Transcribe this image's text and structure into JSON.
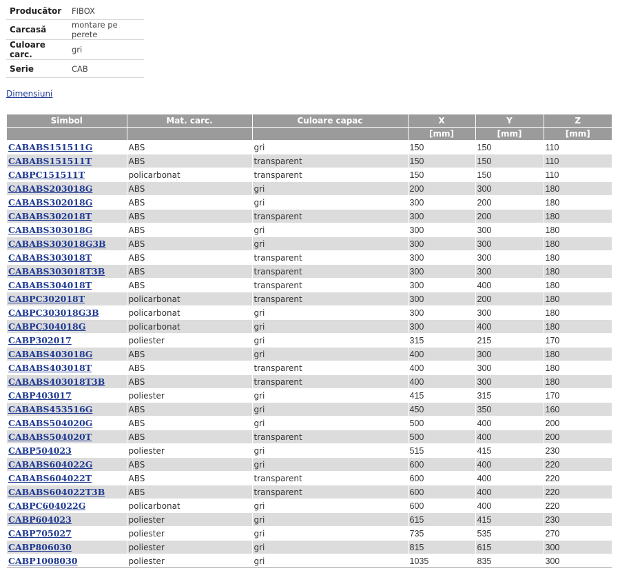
{
  "specs": [
    {
      "label": "Producător",
      "value": "FIBOX"
    },
    {
      "label": "Carcasă",
      "value": "montare pe perete"
    },
    {
      "label": "Culoare carc.",
      "value": "gri"
    },
    {
      "label": "Serie",
      "value": "CAB"
    }
  ],
  "dimensions_link": "Dimensiuni",
  "table": {
    "headers": [
      "Simbol",
      "Mat. carc.",
      "Culoare capac",
      "X",
      "Y",
      "Z"
    ],
    "units": [
      "",
      "",
      "",
      "[mm]",
      "[mm]",
      "[mm]"
    ],
    "rows": [
      [
        "CABABS151511G",
        "ABS",
        "gri",
        "150",
        "150",
        "110"
      ],
      [
        "CABABS151511T",
        "ABS",
        "transparent",
        "150",
        "150",
        "110"
      ],
      [
        "CABPC151511T",
        "policarbonat",
        "transparent",
        "150",
        "150",
        "110"
      ],
      [
        "CABABS203018G",
        "ABS",
        "gri",
        "200",
        "300",
        "180"
      ],
      [
        "CABABS302018G",
        "ABS",
        "gri",
        "300",
        "200",
        "180"
      ],
      [
        "CABABS302018T",
        "ABS",
        "transparent",
        "300",
        "200",
        "180"
      ],
      [
        "CABABS303018G",
        "ABS",
        "gri",
        "300",
        "300",
        "180"
      ],
      [
        "CABABS303018G3B",
        "ABS",
        "gri",
        "300",
        "300",
        "180"
      ],
      [
        "CABABS303018T",
        "ABS",
        "transparent",
        "300",
        "300",
        "180"
      ],
      [
        "CABABS303018T3B",
        "ABS",
        "transparent",
        "300",
        "300",
        "180"
      ],
      [
        "CABABS304018T",
        "ABS",
        "transparent",
        "300",
        "400",
        "180"
      ],
      [
        "CABPC302018T",
        "policarbonat",
        "transparent",
        "300",
        "200",
        "180"
      ],
      [
        "CABPC303018G3B",
        "policarbonat",
        "gri",
        "300",
        "300",
        "180"
      ],
      [
        "CABPC304018G",
        "policarbonat",
        "gri",
        "300",
        "400",
        "180"
      ],
      [
        "CABP302017",
        "poliester",
        "gri",
        "315",
        "215",
        "170"
      ],
      [
        "CABABS403018G",
        "ABS",
        "gri",
        "400",
        "300",
        "180"
      ],
      [
        "CABABS403018T",
        "ABS",
        "transparent",
        "400",
        "300",
        "180"
      ],
      [
        "CABABS403018T3B",
        "ABS",
        "transparent",
        "400",
        "300",
        "180"
      ],
      [
        "CABP403017",
        "poliester",
        "gri",
        "415",
        "315",
        "170"
      ],
      [
        "CABABS453516G",
        "ABS",
        "gri",
        "450",
        "350",
        "160"
      ],
      [
        "CABABS504020G",
        "ABS",
        "gri",
        "500",
        "400",
        "200"
      ],
      [
        "CABABS504020T",
        "ABS",
        "transparent",
        "500",
        "400",
        "200"
      ],
      [
        "CABP504023",
        "poliester",
        "gri",
        "515",
        "415",
        "230"
      ],
      [
        "CABABS604022G",
        "ABS",
        "gri",
        "600",
        "400",
        "220"
      ],
      [
        "CABABS604022T",
        "ABS",
        "transparent",
        "600",
        "400",
        "220"
      ],
      [
        "CABABS604022T3B",
        "ABS",
        "transparent",
        "600",
        "400",
        "220"
      ],
      [
        "CABPC604022G",
        "policarbonat",
        "gri",
        "600",
        "400",
        "220"
      ],
      [
        "CABP604023",
        "poliester",
        "gri",
        "615",
        "415",
        "230"
      ],
      [
        "CABP705027",
        "poliester",
        "gri",
        "735",
        "535",
        "270"
      ],
      [
        "CABP806030",
        "poliester",
        "gri",
        "815",
        "615",
        "300"
      ],
      [
        "CABP1008030",
        "poliester",
        "gri",
        "1035",
        "835",
        "300"
      ]
    ]
  },
  "colors": {
    "header_bg": "#9b9b9b",
    "row_alt_bg": "#dcdcdc",
    "link": "#1f3a93"
  }
}
